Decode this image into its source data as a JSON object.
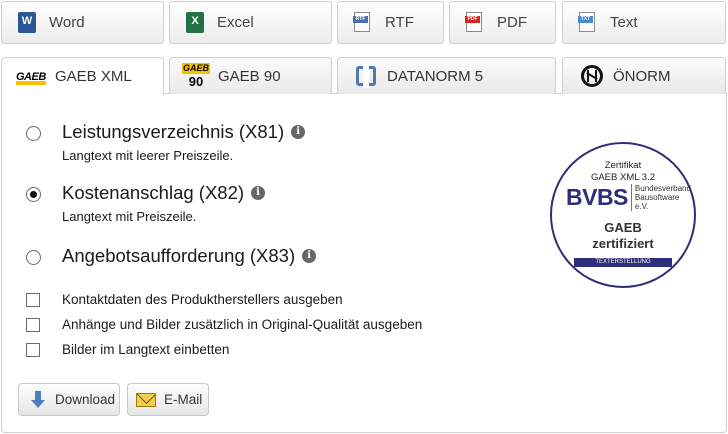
{
  "formats": [
    {
      "label": "Word",
      "icon": "word-icon"
    },
    {
      "label": "Excel",
      "icon": "excel-icon"
    },
    {
      "label": "RTF",
      "icon": "rtf-icon"
    },
    {
      "label": "PDF",
      "icon": "pdf-icon"
    },
    {
      "label": "Text",
      "icon": "text-file-icon"
    }
  ],
  "format_icon_text": {
    "rtf": "RTF",
    "pdf": "PDF",
    "txt": "TXT"
  },
  "standards": [
    {
      "label": "GAEB XML",
      "icon": "gaeb-logo",
      "active": true
    },
    {
      "label": "GAEB 90",
      "icon": "gaeb90-logo",
      "active": false
    },
    {
      "label": "DATANORM 5",
      "icon": "datanorm-logo",
      "active": false
    },
    {
      "label": "ÖNORM",
      "icon": "oenorm-logo",
      "active": false
    }
  ],
  "logos": {
    "gaeb": "GAEB",
    "gaeb90_top": "GAEB",
    "gaeb90_num": "90"
  },
  "options": [
    {
      "title": "Leistungsverzeichnis (X81)",
      "subtitle": "Langtext mit leerer Preiszeile.",
      "checked": false
    },
    {
      "title": "Kostenanschlag (X82)",
      "subtitle": "Langtext mit Preiszeile.",
      "checked": true
    },
    {
      "title": "Angebotsaufforderung (X83)",
      "subtitle": "",
      "checked": false
    }
  ],
  "info_glyph": "i",
  "checkboxes": [
    {
      "label": "Kontaktdaten des Produktherstellers ausgeben",
      "checked": false
    },
    {
      "label": "Anhänge und Bilder zusätzlich in Original-Qualität ausgeben",
      "checked": false
    },
    {
      "label": "Bilder im Langtext einbetten",
      "checked": false
    }
  ],
  "buttons": {
    "download": "Download",
    "email": "E-Mail"
  },
  "seal": {
    "line1": "Zertifikat",
    "line2": "GAEB XML 3.2",
    "bvbs": "BVBS",
    "bvbs_name_1": "Bundesverband",
    "bvbs_name_2": "Bausoftware e.V.",
    "gaeb": "GAEB",
    "zertifiziert": "zertifiziert",
    "band": "TEXTERSTELLUNG",
    "ring_color": "#2e2e7a"
  },
  "colors": {
    "gaeb_yellow": "#f2c500",
    "word_blue": "#2b5797",
    "excel_green": "#217346",
    "pdf_red": "#d7261e"
  }
}
